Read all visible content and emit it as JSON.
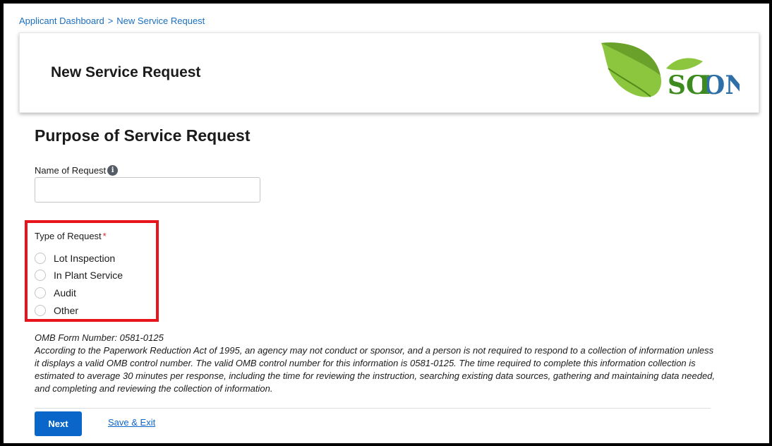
{
  "breadcrumb": {
    "items": [
      "Applicant Dashboard",
      "New Service Request"
    ],
    "separator": ">"
  },
  "header": {
    "title": "New Service Request",
    "logo_text": "SCION",
    "logo_icon": "leaf-icon"
  },
  "section": {
    "title": "Purpose of Service Request"
  },
  "form": {
    "name_label": "Name of Request",
    "name_value": "",
    "info_icon": "info-icon",
    "type_label": "Type of Request",
    "required_marker": "*",
    "type_options": [
      "Lot Inspection",
      "In Plant Service",
      "Audit",
      "Other"
    ]
  },
  "omb": {
    "form_number": "OMB Form Number: 0581-0125",
    "notice": "According to the Paperwork Reduction Act of 1995, an agency may not conduct or sponsor, and a person is not required to respond to a collection of information unless it displays a valid OMB control number. The valid OMB control number for this information is 0581-0125. The time required to complete this information collection is estimated to average 30 minutes per response, including the time for reviewing the instruction, searching existing data sources, gathering and maintaining data needed, and completing and reviewing the collection of information."
  },
  "actions": {
    "next_label": "Next",
    "save_exit_label": "Save & Exit"
  },
  "colors": {
    "primary": "#0a66c8",
    "link": "#1a6fbf",
    "highlight": "#e8141b",
    "logo_green": "#7dbb2a",
    "logo_text": "#3d8a1f"
  }
}
